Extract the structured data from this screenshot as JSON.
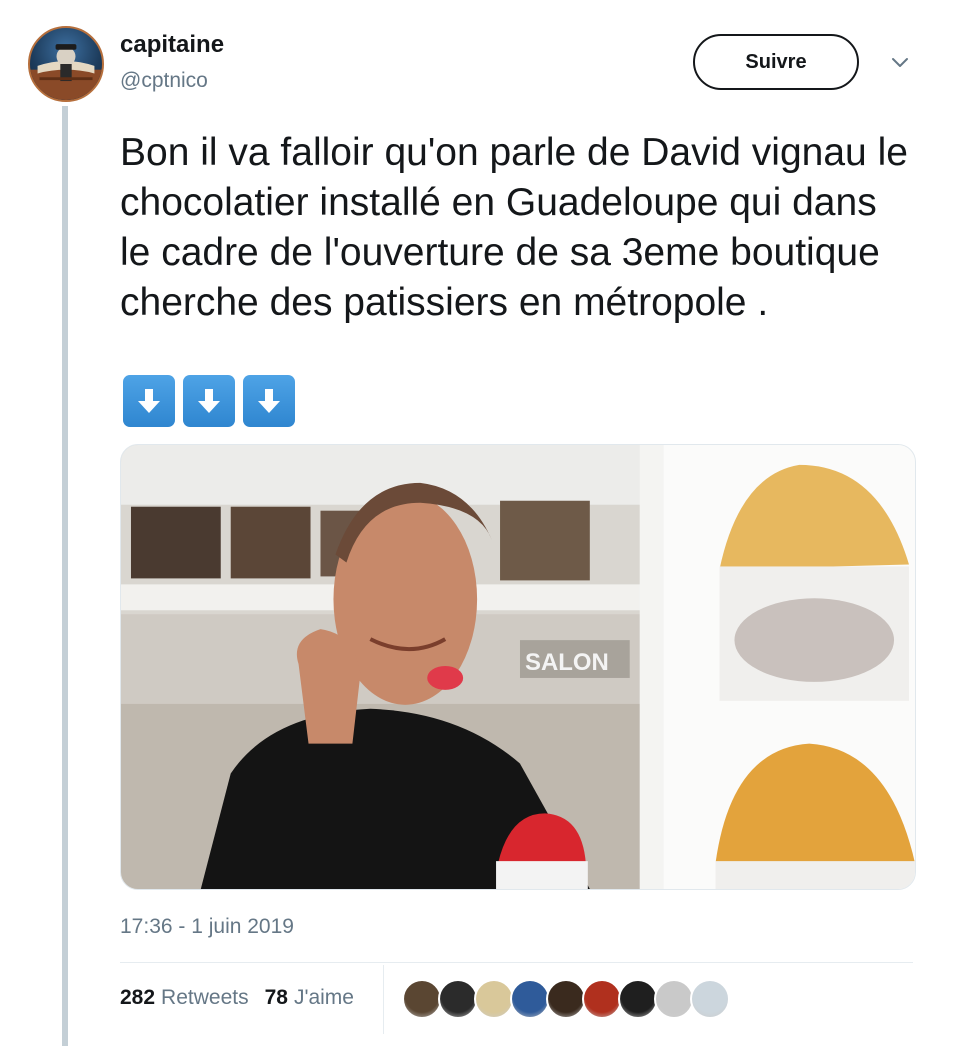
{
  "author": {
    "name": "capitaine",
    "handle": "@cptnico",
    "avatar_icon": "pirate-avatar"
  },
  "actions": {
    "follow_label": "Suivre",
    "more_icon": "chevron-down-icon"
  },
  "tweet": {
    "text": "Bon il va falloir qu'on parle de David vignau le chocolatier installé en Guadeloupe qui dans le cadre de l'ouverture de sa 3eme boutique cherche des patissiers en métropole .",
    "emoji": [
      "arrow-down-emoji",
      "arrow-down-emoji",
      "arrow-down-emoji"
    ],
    "media": {
      "type": "photo",
      "sign_text": "SALON"
    },
    "timestamp": "17:36 - 1 juin 2019"
  },
  "stats": {
    "retweets_count": "282",
    "retweets_label": "Retweets",
    "likes_count": "78",
    "likes_label": "J'aime"
  },
  "likers": [
    {
      "name": "liker-avatar-1",
      "color": "#5a4632"
    },
    {
      "name": "liker-avatar-2",
      "color": "#2b2b2b"
    },
    {
      "name": "liker-avatar-3",
      "color": "#d9c89a"
    },
    {
      "name": "liker-avatar-4",
      "color": "#2f5b9a"
    },
    {
      "name": "liker-avatar-5",
      "color": "#3a2a1e"
    },
    {
      "name": "liker-avatar-6",
      "color": "#b0301e"
    },
    {
      "name": "liker-avatar-7",
      "color": "#1f1f1f"
    },
    {
      "name": "liker-avatar-8",
      "color": "#c9c9c9"
    },
    {
      "name": "liker-avatar-9",
      "color": "#ccd6dd"
    }
  ],
  "colors": {
    "text_primary": "#14171a",
    "text_secondary": "#657786",
    "emoji_blue": "#3b93d9"
  }
}
